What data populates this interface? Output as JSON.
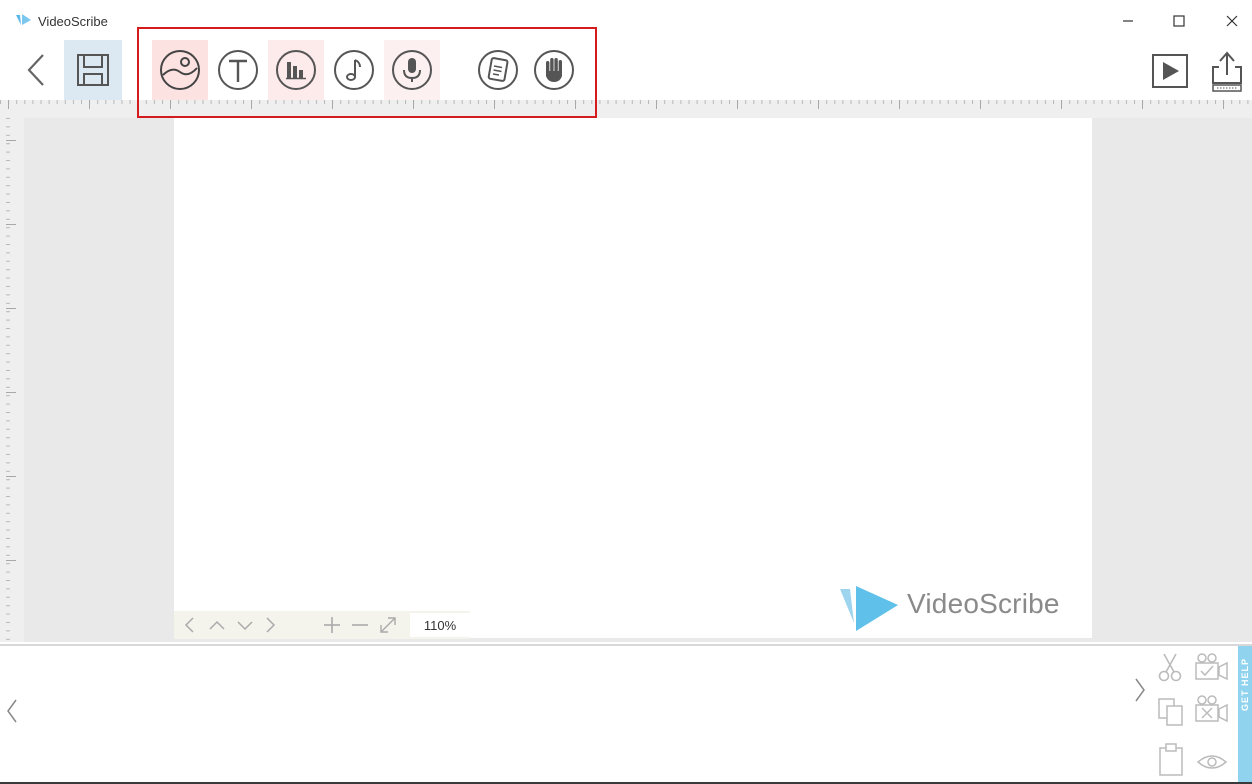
{
  "window": {
    "title": "VideoScribe",
    "minimize_icon": "minimize-icon",
    "maximize_icon": "maximize-icon",
    "close_icon": "close-icon"
  },
  "toolbar": {
    "left": [
      "back-icon",
      "save-icon"
    ],
    "insert_tools": [
      "image-icon",
      "text-icon",
      "chart-icon",
      "music-icon",
      "voiceover-icon",
      "notes-icon",
      "hand-icon"
    ],
    "right": [
      "play-icon",
      "export-icon"
    ]
  },
  "canvas": {
    "zoom_level": "110%",
    "watermark": "VideoScribe",
    "nav_controls": [
      "chevron-left-icon",
      "chevron-up-icon",
      "chevron-down-icon",
      "chevron-right-icon",
      "zoom-in-icon",
      "zoom-out-icon",
      "fit-screen-icon"
    ]
  },
  "timeline": {
    "tools": [
      "cut-icon",
      "camera-set-icon",
      "copy-icon",
      "camera-clear-icon",
      "paste-icon",
      "preview-icon"
    ],
    "get_help_label": "GET HELP"
  },
  "colors": {
    "highlight_red": "#d41c1c",
    "save_highlight": "#dce9f2",
    "active_pink": "#fde2e2",
    "get_help_blue": "#8fd3ee"
  }
}
